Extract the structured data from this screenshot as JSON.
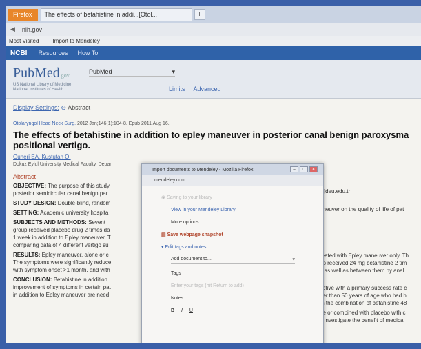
{
  "browser": {
    "firefox_button": "Firefox",
    "tab_title": "The effects of betahistine in addi...[Otol...",
    "new_tab": "+",
    "url_domain": "nih.gov",
    "bookmarks": [
      "Most Visited",
      "Import to Mendeley"
    ]
  },
  "ncbi": {
    "logo": "NCBI",
    "nav": [
      "Resources",
      "How To"
    ]
  },
  "pubmed": {
    "logo": "PubMed",
    "logo_gov": ".gov",
    "subtitle": "US National Library of Medicine National Institutes of Health",
    "db_select": "PubMed",
    "links": [
      "Limits",
      "Advanced"
    ]
  },
  "article": {
    "display_settings": "Display Settings:",
    "display_mode": "Abstract",
    "journal": "Otolaryngol Head Neck Surg.",
    "citation": "2012 Jan;146(1):104-8. Epub 2011 Aug 16.",
    "title_line1": "The effects of betahistine in addition to epley maneuver in posterior canal benign paroxysma",
    "title_line2": "positional vertigo.",
    "authors": "Guneri EA, Kustutan O.",
    "affiliation": "Dokuz Eylul University Medical Faculty, Depar",
    "affiliation_right": "@deu.edu.tr",
    "abstract_heading": "Abstract",
    "sections": [
      {
        "label": "OBJECTIVE:",
        "text": "The purpose of this study",
        "line2": "posterior semicircular canal benign par",
        "right": "aneuver on the quality of life of pat"
      },
      {
        "label": "STUDY DESIGN:",
        "text": "Double-blind, random"
      },
      {
        "label": "SETTING:",
        "text": "Academic university hospita"
      },
      {
        "label": "SUBJECTS AND METHODS:",
        "text": "Sevent",
        "line2": "group received placebo drug 2 times da",
        "line3": "1 week in addition to Epley maneuver. T",
        "line4": "comparing data of 4 different vertigo su",
        "right": "reated with Epley maneuver only. Th",
        "right2": "up received 24 mg betahistine 2 tim",
        "right3": "p as well as between them by anal"
      },
      {
        "label": "RESULTS:",
        "text": "Epley maneuver, alone or c",
        "line2": "The symptoms were significantly reduce",
        "line3": "with symptom onset >1 month, and with",
        "right": "ective with a primary success rate c",
        "right2": "der than 50 years of age who had h",
        "right3": "th the combination of betahistine 48"
      },
      {
        "label": "CONCLUSION:",
        "text": "Betahistine in addition",
        "line2": "improvement of symptoms in certain pat",
        "line3": "in addition to Epley maneuver are need",
        "right": "ne or combined with placebo with c",
        "right2": "o investigate the benefit of medica"
      }
    ]
  },
  "popup": {
    "window_title": "Import documents to Mendeley - Mozilla Firefox",
    "url_domain": "mendeley.com",
    "saving_text": "Saving to your library",
    "view_library": "View in your Mendeley Library",
    "more_options": "More options",
    "save_snapshot": "Save webpage snapshot",
    "edit_tags": "Edit tags and notes",
    "add_document": "Add document to...",
    "tags_label": "Tags",
    "tags_placeholder": "Enter your tags (hit Return to add)",
    "notes_label": "Notes",
    "format_buttons": [
      "B",
      "I",
      "U"
    ]
  }
}
